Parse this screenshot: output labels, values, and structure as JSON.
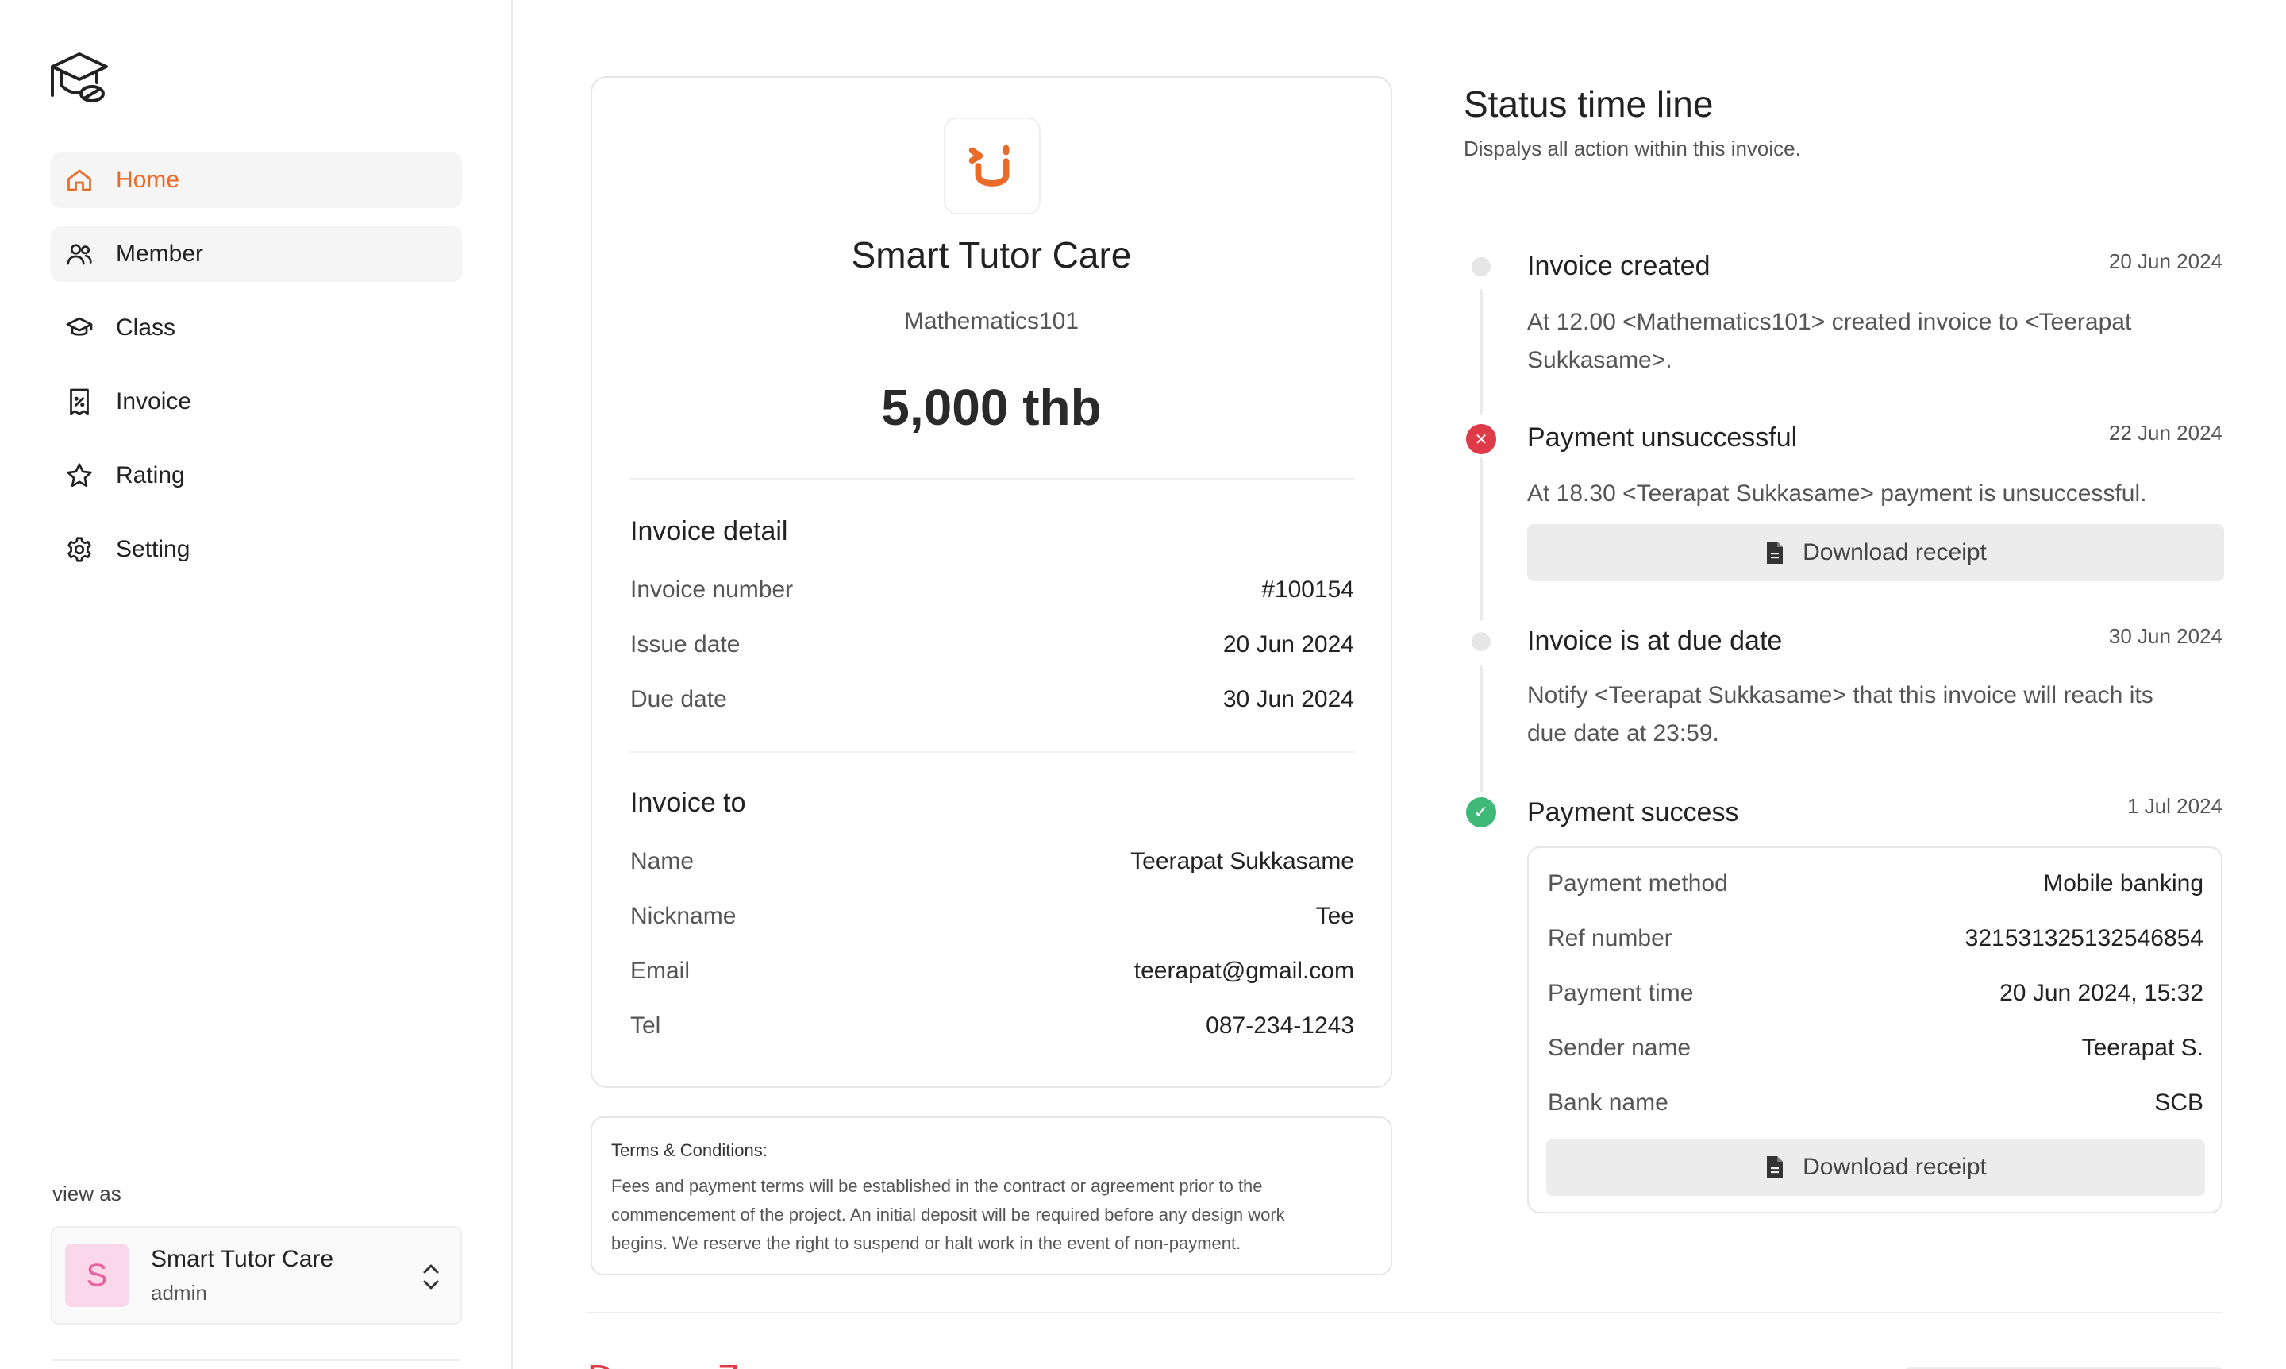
{
  "sidebar": {
    "items": [
      {
        "label": "Home",
        "icon": "home-icon"
      },
      {
        "label": "Member",
        "icon": "users-icon"
      },
      {
        "label": "Class",
        "icon": "graduation-cap-icon"
      },
      {
        "label": "Invoice",
        "icon": "receipt-icon"
      },
      {
        "label": "Rating",
        "icon": "star-icon"
      },
      {
        "label": "Setting",
        "icon": "gear-icon"
      }
    ],
    "view_as_label": "view as",
    "account": {
      "initial": "S",
      "name": "Smart Tutor Care",
      "role": "admin"
    }
  },
  "invoice": {
    "brand_name": "Smart Tutor Care",
    "class_name": "Mathematics101",
    "amount": "5,000 thb",
    "detail": {
      "title": "Invoice detail",
      "rows": [
        {
          "k": "Invoice number",
          "v": "#100154"
        },
        {
          "k": "Issue date",
          "v": "20 Jun 2024"
        },
        {
          "k": "Due date",
          "v": "30 Jun 2024"
        }
      ]
    },
    "to": {
      "title": "Invoice to",
      "rows": [
        {
          "k": "Name",
          "v": "Teerapat Sukkasame"
        },
        {
          "k": "Nickname",
          "v": "Tee"
        },
        {
          "k": "Email",
          "v": "teerapat@gmail.com"
        },
        {
          "k": "Tel",
          "v": "087-234-1243"
        }
      ]
    }
  },
  "terms": {
    "title": "Terms & Conditions:",
    "line1": "Fees and payment terms will be established in the contract or agreement prior to the",
    "line2": "commencement of the project. An initial deposit will be required before any design work",
    "line3": "begins. We reserve the right to suspend or halt work in the event of non-payment."
  },
  "timeline": {
    "title": "Status time line",
    "subtitle": "Dispalys all action within this invoice.",
    "events": [
      {
        "title": "Invoice created",
        "date": "20 Jun 2024",
        "desc1": "At 12.00 <Mathematics101> created invoice to <Teerapat",
        "desc2": "Sukkasame>."
      },
      {
        "title": "Payment unsuccessful",
        "date": "22 Jun 2024",
        "desc1": "At 18.30 <Teerapat Sukkasame> payment is unsuccessful.",
        "button": "Download receipt"
      },
      {
        "title": "Invoice is at due date",
        "date": "30 Jun 2024",
        "desc1": "Notify <Teerapat Sukkasame> that this invoice will reach its",
        "desc2": "due date at 23:59."
      },
      {
        "title": "Payment success",
        "date": "1  Jul 2024",
        "button": "Download receipt"
      }
    ],
    "payment": [
      {
        "k": "Payment method",
        "v": "Mobile banking"
      },
      {
        "k": "Ref number",
        "v": "321531325132546854"
      },
      {
        "k": "Payment time",
        "v": "20 Jun 2024, 15:32"
      },
      {
        "k": "Sender name",
        "v": "Teerapat S."
      },
      {
        "k": "Bank name",
        "v": "SCB"
      }
    ]
  },
  "danger_zone": {
    "title": "Danger Zone"
  },
  "colors": {
    "accent": "#ea6a28",
    "danger": "#df3a48",
    "success": "#3fb878"
  }
}
